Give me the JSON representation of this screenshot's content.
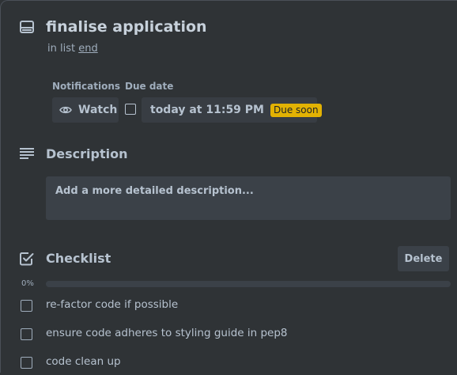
{
  "card": {
    "title": "finalise application",
    "in_list_prefix": "in list",
    "list_name": "end"
  },
  "notifications": {
    "label": "Notifications",
    "watch_label": "Watch"
  },
  "due_date": {
    "label": "Due date",
    "value": "today at 11:59 PM",
    "badge": "Due soon",
    "badge_color": "#e2b203"
  },
  "description": {
    "title": "Description",
    "placeholder": "Add a more detailed description..."
  },
  "checklist": {
    "title": "Checklist",
    "delete_label": "Delete",
    "progress_label": "0%",
    "progress_percent": 0,
    "items": [
      {
        "text": "re-factor code if possible",
        "checked": false
      },
      {
        "text": "ensure code adheres to styling guide in pep8",
        "checked": false
      },
      {
        "text": "code clean up",
        "checked": false
      }
    ]
  },
  "icons": {
    "card": "card-icon",
    "watch": "eye-icon",
    "chevron": "chevron-down-icon",
    "description": "description-lines-icon",
    "checklist": "checklist-icon"
  }
}
